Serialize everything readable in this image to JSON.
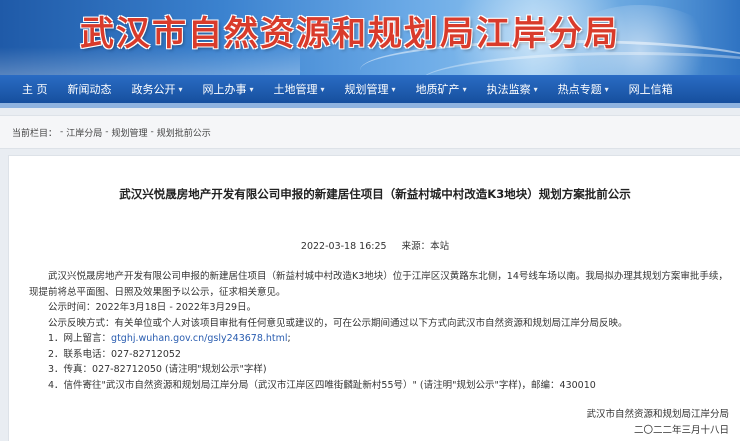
{
  "header": {
    "site_title": "武汉市自然资源和规划局江岸分局"
  },
  "nav": {
    "items": [
      {
        "label": "主 页",
        "dropdown": false
      },
      {
        "label": "新闻动态",
        "dropdown": false
      },
      {
        "label": "政务公开",
        "dropdown": true
      },
      {
        "label": "网上办事",
        "dropdown": true
      },
      {
        "label": "土地管理",
        "dropdown": true
      },
      {
        "label": "规划管理",
        "dropdown": true
      },
      {
        "label": "地质矿产",
        "dropdown": true
      },
      {
        "label": "执法监察",
        "dropdown": true
      },
      {
        "label": "热点专题",
        "dropdown": true
      },
      {
        "label": "网上信箱",
        "dropdown": false
      }
    ],
    "caret": "▾"
  },
  "breadcrumb": {
    "prefix": "当前栏目：",
    "sep": "-",
    "items": [
      "江岸分局",
      "规划管理",
      "规划批前公示"
    ]
  },
  "article": {
    "title": "武汉兴悦晟房地产开发有限公司申报的新建居住项目（新益村城中村改造K3地块）规划方案批前公示",
    "date": "2022-03-18 16:25",
    "source": "来源：本站",
    "para1": "武汉兴悦晟房地产开发有限公司申报的新建居住项目（新益村城中村改造K3地块）位于江岸区汉黄路东北侧，14号线车场以南。我局拟办理其规划方案审批手续，现提前将总平面图、日照及效果图予以公示，征求相关意见。",
    "period": "公示时间：2022年3月18日 - 2022年3月29日。",
    "feedback": "公示反映方式：有关单位或个人对该项目审批有任何意见或建议的，可在公示期间通过以下方式向武汉市自然资源和规划局江岸分局反映。",
    "item1_label": "1．网上留言：",
    "item1_link": "gtghj.wuhan.gov.cn/gsly243678.html",
    "item1_end": ";",
    "item2": "2．联系电话：027-82712052",
    "item3": "3．传真：027-82712050 (请注明\"规划公示\"字样)",
    "item4": "4．信件寄往\"武汉市自然资源和规划局江岸分局（武汉市江岸区四唯街麟趾新村55号）\" (请注明\"规划公示\"字样)，邮编：430010",
    "sign_org": "武汉市自然资源和规划局江岸分局",
    "sign_date": "二〇二二年三月十八日"
  }
}
